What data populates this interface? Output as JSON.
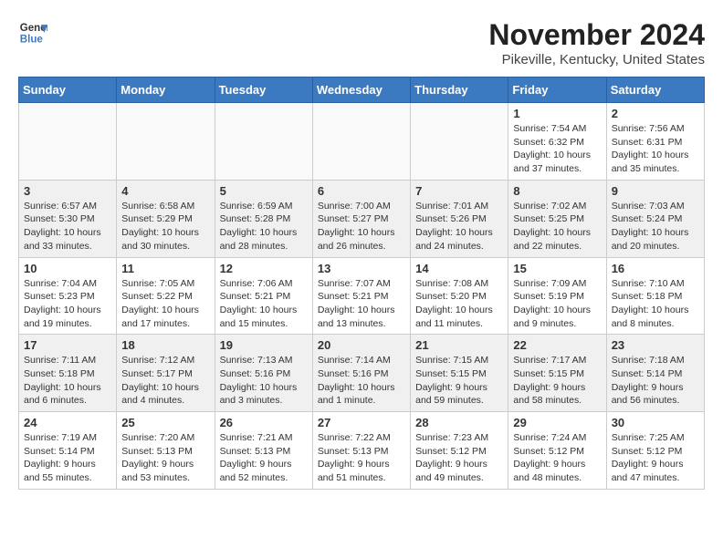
{
  "header": {
    "logo_line1": "General",
    "logo_line2": "Blue",
    "month": "November 2024",
    "location": "Pikeville, Kentucky, United States"
  },
  "days_of_week": [
    "Sunday",
    "Monday",
    "Tuesday",
    "Wednesday",
    "Thursday",
    "Friday",
    "Saturday"
  ],
  "weeks": [
    [
      {
        "day": "",
        "info": ""
      },
      {
        "day": "",
        "info": ""
      },
      {
        "day": "",
        "info": ""
      },
      {
        "day": "",
        "info": ""
      },
      {
        "day": "",
        "info": ""
      },
      {
        "day": "1",
        "info": "Sunrise: 7:54 AM\nSunset: 6:32 PM\nDaylight: 10 hours and 37 minutes."
      },
      {
        "day": "2",
        "info": "Sunrise: 7:56 AM\nSunset: 6:31 PM\nDaylight: 10 hours and 35 minutes."
      }
    ],
    [
      {
        "day": "3",
        "info": "Sunrise: 6:57 AM\nSunset: 5:30 PM\nDaylight: 10 hours and 33 minutes."
      },
      {
        "day": "4",
        "info": "Sunrise: 6:58 AM\nSunset: 5:29 PM\nDaylight: 10 hours and 30 minutes."
      },
      {
        "day": "5",
        "info": "Sunrise: 6:59 AM\nSunset: 5:28 PM\nDaylight: 10 hours and 28 minutes."
      },
      {
        "day": "6",
        "info": "Sunrise: 7:00 AM\nSunset: 5:27 PM\nDaylight: 10 hours and 26 minutes."
      },
      {
        "day": "7",
        "info": "Sunrise: 7:01 AM\nSunset: 5:26 PM\nDaylight: 10 hours and 24 minutes."
      },
      {
        "day": "8",
        "info": "Sunrise: 7:02 AM\nSunset: 5:25 PM\nDaylight: 10 hours and 22 minutes."
      },
      {
        "day": "9",
        "info": "Sunrise: 7:03 AM\nSunset: 5:24 PM\nDaylight: 10 hours and 20 minutes."
      }
    ],
    [
      {
        "day": "10",
        "info": "Sunrise: 7:04 AM\nSunset: 5:23 PM\nDaylight: 10 hours and 19 minutes."
      },
      {
        "day": "11",
        "info": "Sunrise: 7:05 AM\nSunset: 5:22 PM\nDaylight: 10 hours and 17 minutes."
      },
      {
        "day": "12",
        "info": "Sunrise: 7:06 AM\nSunset: 5:21 PM\nDaylight: 10 hours and 15 minutes."
      },
      {
        "day": "13",
        "info": "Sunrise: 7:07 AM\nSunset: 5:21 PM\nDaylight: 10 hours and 13 minutes."
      },
      {
        "day": "14",
        "info": "Sunrise: 7:08 AM\nSunset: 5:20 PM\nDaylight: 10 hours and 11 minutes."
      },
      {
        "day": "15",
        "info": "Sunrise: 7:09 AM\nSunset: 5:19 PM\nDaylight: 10 hours and 9 minutes."
      },
      {
        "day": "16",
        "info": "Sunrise: 7:10 AM\nSunset: 5:18 PM\nDaylight: 10 hours and 8 minutes."
      }
    ],
    [
      {
        "day": "17",
        "info": "Sunrise: 7:11 AM\nSunset: 5:18 PM\nDaylight: 10 hours and 6 minutes."
      },
      {
        "day": "18",
        "info": "Sunrise: 7:12 AM\nSunset: 5:17 PM\nDaylight: 10 hours and 4 minutes."
      },
      {
        "day": "19",
        "info": "Sunrise: 7:13 AM\nSunset: 5:16 PM\nDaylight: 10 hours and 3 minutes."
      },
      {
        "day": "20",
        "info": "Sunrise: 7:14 AM\nSunset: 5:16 PM\nDaylight: 10 hours and 1 minute."
      },
      {
        "day": "21",
        "info": "Sunrise: 7:15 AM\nSunset: 5:15 PM\nDaylight: 9 hours and 59 minutes."
      },
      {
        "day": "22",
        "info": "Sunrise: 7:17 AM\nSunset: 5:15 PM\nDaylight: 9 hours and 58 minutes."
      },
      {
        "day": "23",
        "info": "Sunrise: 7:18 AM\nSunset: 5:14 PM\nDaylight: 9 hours and 56 minutes."
      }
    ],
    [
      {
        "day": "24",
        "info": "Sunrise: 7:19 AM\nSunset: 5:14 PM\nDaylight: 9 hours and 55 minutes."
      },
      {
        "day": "25",
        "info": "Sunrise: 7:20 AM\nSunset: 5:13 PM\nDaylight: 9 hours and 53 minutes."
      },
      {
        "day": "26",
        "info": "Sunrise: 7:21 AM\nSunset: 5:13 PM\nDaylight: 9 hours and 52 minutes."
      },
      {
        "day": "27",
        "info": "Sunrise: 7:22 AM\nSunset: 5:13 PM\nDaylight: 9 hours and 51 minutes."
      },
      {
        "day": "28",
        "info": "Sunrise: 7:23 AM\nSunset: 5:12 PM\nDaylight: 9 hours and 49 minutes."
      },
      {
        "day": "29",
        "info": "Sunrise: 7:24 AM\nSunset: 5:12 PM\nDaylight: 9 hours and 48 minutes."
      },
      {
        "day": "30",
        "info": "Sunrise: 7:25 AM\nSunset: 5:12 PM\nDaylight: 9 hours and 47 minutes."
      }
    ]
  ]
}
